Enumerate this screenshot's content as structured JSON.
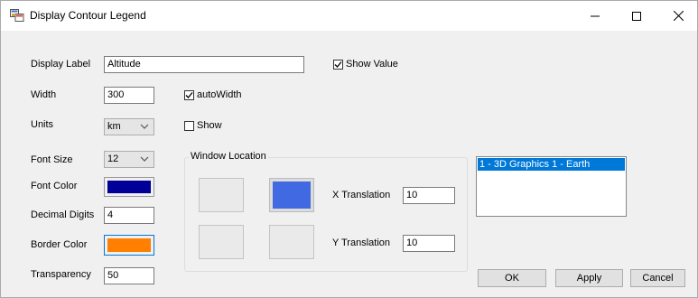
{
  "window": {
    "title": "Display Contour Legend"
  },
  "form": {
    "display_label": {
      "label": "Display Label",
      "value": "Altitude"
    },
    "show_value": {
      "label": "Show Value",
      "checked": true
    },
    "width": {
      "label": "Width",
      "value": "300"
    },
    "auto_width": {
      "label": "autoWidth",
      "checked": true
    },
    "units": {
      "label": "Units",
      "value": "km"
    },
    "show": {
      "label": "Show",
      "checked": false
    },
    "font_size": {
      "label": "Font Size",
      "value": "12"
    },
    "font_color": {
      "label": "Font Color",
      "color": "#000099"
    },
    "decimal_digits": {
      "label": "Decimal Digits",
      "value": "4"
    },
    "border_color": {
      "label": "Border Color",
      "color": "#ff8000"
    },
    "transparency": {
      "label": "Transparency",
      "value": "50"
    }
  },
  "window_location": {
    "title": "Window Location",
    "selected_color": "#4169e1",
    "x_translation": {
      "label": "X Translation",
      "value": "10"
    },
    "y_translation": {
      "label": "Y Translation",
      "value": "10"
    }
  },
  "graphics_list": {
    "items": [
      "1 - 3D Graphics 1 - Earth"
    ]
  },
  "buttons": {
    "ok": "OK",
    "apply": "Apply",
    "cancel": "Cancel"
  },
  "icons": [
    "app-icon",
    "minimize-icon",
    "maximize-icon",
    "close-icon",
    "checkmark-icon",
    "chevron-down-icon"
  ]
}
